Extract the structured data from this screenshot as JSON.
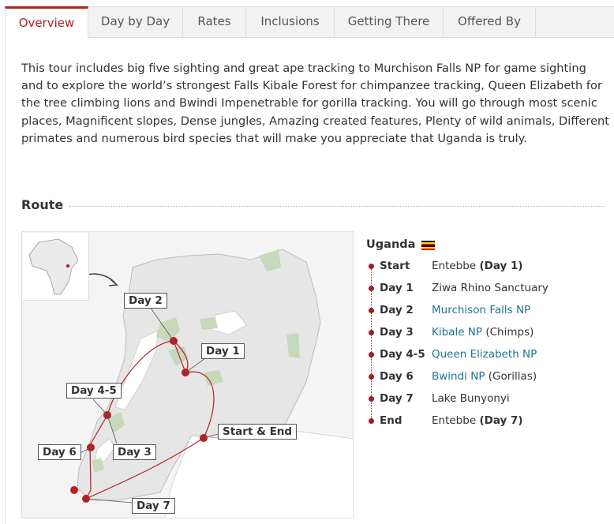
{
  "tabs": [
    {
      "label": "Overview",
      "active": true
    },
    {
      "label": "Day by Day"
    },
    {
      "label": "Rates"
    },
    {
      "label": "Inclusions"
    },
    {
      "label": "Getting There"
    },
    {
      "label": "Offered By"
    }
  ],
  "intro": "This tour includes big five sighting and great ape tracking to Murchison Falls NP for game sighting and to explore the world’s strongest Falls Kibale Forest for chimpanzee tracking, Queen Elizabeth for the tree climbing lions and Bwindi Impenetrable for gorilla tracking. You will go through most scenic places, Magnificent slopes, Dense jungles, Amazing created features, Plenty of wild animals, Different primates and numerous bird species that will make you appreciate that Uganda is truly.",
  "route": {
    "title": "Route",
    "map_labels": {
      "day2": "Day 2",
      "day1": "Day 1",
      "day45": "Day 4-5",
      "start_end": "Start & End",
      "day6": "Day 6",
      "day3": "Day 3",
      "day7": "Day 7"
    },
    "country": "Uganda",
    "itinerary": [
      {
        "day": "Start",
        "place": "Entebbe",
        "suffix_bold": "(Day 1)"
      },
      {
        "day": "Day 1",
        "place": "Ziwa Rhino Sanctuary"
      },
      {
        "day": "Day 2",
        "place_link": "Murchison Falls NP"
      },
      {
        "day": "Day 3",
        "place_link": "Kibale NP",
        "suffix": "(Chimps)"
      },
      {
        "day": "Day 4-5",
        "place_link": "Queen Elizabeth NP"
      },
      {
        "day": "Day 6",
        "place_link": "Bwindi NP",
        "suffix": "(Gorillas)"
      },
      {
        "day": "Day 7",
        "place": "Lake Bunyonyi"
      },
      {
        "day": "End",
        "place": "Entebbe",
        "suffix_bold": "(Day 7)"
      }
    ]
  },
  "colors": {
    "accent": "#b52025",
    "link": "#1e7390",
    "route_dot": "#a01c22",
    "park": "#c6d9bb",
    "water": "#ffffff"
  }
}
